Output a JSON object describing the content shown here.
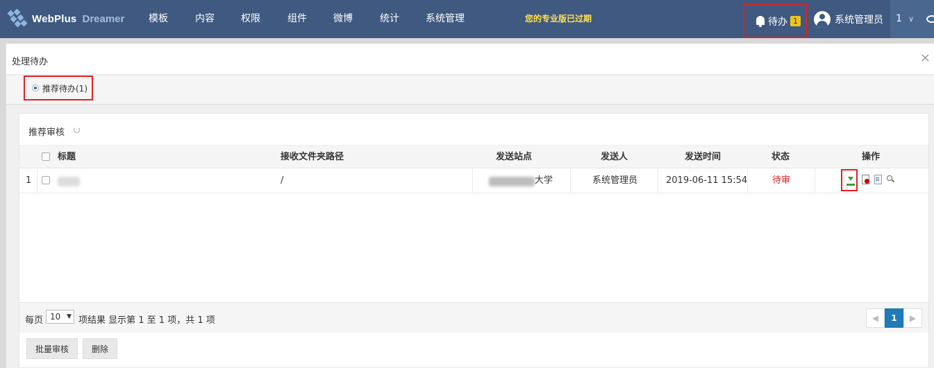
{
  "header": {
    "logo_text": "WebPlus",
    "logo_sub": "Dreamer",
    "nav": [
      "模板",
      "内容",
      "权限",
      "组件",
      "微博",
      "统计",
      "系统管理"
    ],
    "expired_notice": "您的专业版已过期",
    "todo_label": "待办",
    "todo_count": "1",
    "user_name": "系统管理员",
    "page_number": "1",
    "chevron": "∨"
  },
  "modal": {
    "title": "处理待办",
    "close": "×",
    "tab_label": "推荐待办(1)"
  },
  "panel": {
    "title": "推荐审核",
    "columns": [
      "标题",
      "接收文件夹路径",
      "发送站点",
      "发送人",
      "发送时间",
      "状态",
      "操作"
    ],
    "rows": [
      {
        "index": "1",
        "title": "",
        "path": "/",
        "site_suffix": "大学",
        "sender": "系统管理员",
        "time": "2019-06-11 15:54",
        "status": "待审"
      }
    ],
    "footer": {
      "per_page_label": "每页",
      "per_page_value": "10",
      "result_text": "项结果  显示第 1 至 1 项，共 1 项",
      "current_page": "1",
      "prev": "◀",
      "next": "▶"
    },
    "buttons": {
      "batch_review": "批量审核",
      "delete": "删除"
    }
  },
  "colors": {
    "topbar": "#3f5980",
    "accent_red": "#e02020",
    "expired_yellow": "#ffe14d",
    "page_active": "#1e7ab8"
  }
}
